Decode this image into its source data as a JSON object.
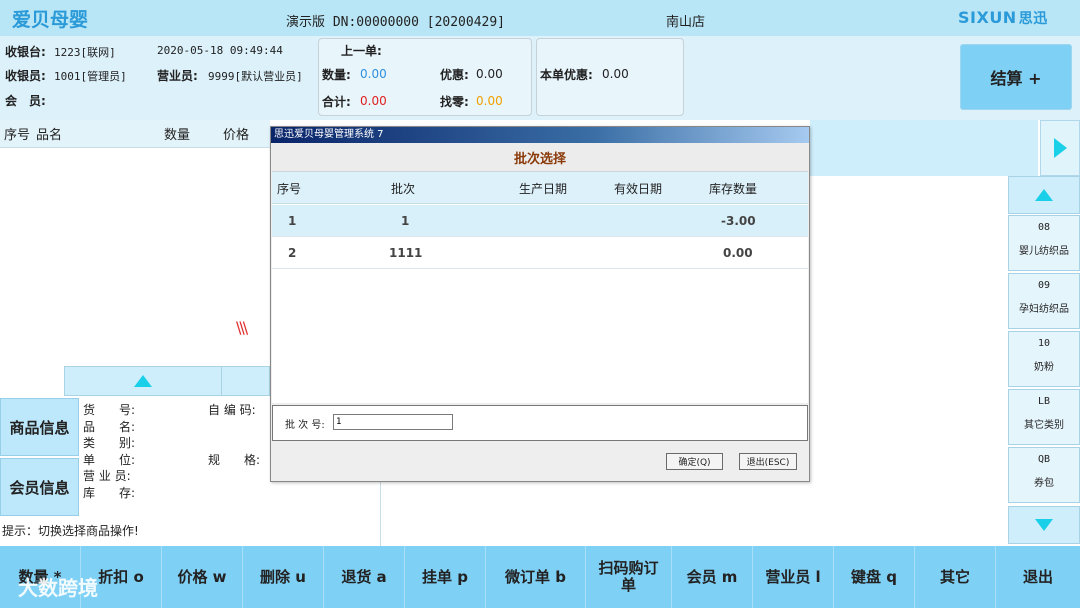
{
  "app": {
    "brand": "爱贝母婴",
    "title": "演示版 DN:00000000 [20200429]",
    "store": "南山店",
    "logo_main": "SIXUN",
    "logo_sub": "思迅"
  },
  "info": {
    "register_label": "收银台:",
    "register_value": "1223[联网]",
    "datetime": "2020-05-18 09:49:44",
    "cashier_label": "收银员:",
    "cashier_value": "1001[管理员]",
    "salesperson_label": "营业员:",
    "salesperson_value": "9999[默认营业员]",
    "member_label": "会　员:",
    "last_order_label": "上一单:",
    "qty_label": "数量:",
    "qty_value": "0.00",
    "discount_label": "优惠:",
    "discount_value": "0.00",
    "total_label": "合计:",
    "total_value": "0.00",
    "change_label": "找零:",
    "change_value": "0.00",
    "order_discount_label": "本单优惠:",
    "order_discount_value": "0.00",
    "checkout_label": "结算 +"
  },
  "list": {
    "col_seq": "序号",
    "col_name": "品名",
    "col_qty": "数量",
    "col_price": "价格",
    "hatch": "\\\\\\"
  },
  "side_buttons": {
    "product_info": "商品信息",
    "member_info": "会员信息"
  },
  "product_panel": {
    "item_no": "货　　号:",
    "name": "品　　名:",
    "category": "类　　别:",
    "unit": "单　　位:",
    "salesperson": "营 业 员:",
    "stock": "库　　存:",
    "self_code": "自 编 码:",
    "spec": "规　　格:"
  },
  "hint": "提示：切换选择商品操作!",
  "categories": [
    {
      "code": "08",
      "name": "婴儿纺织品"
    },
    {
      "code": "09",
      "name": "孕妇纺织品"
    },
    {
      "code": "10",
      "name": "奶粉"
    },
    {
      "code": "LB",
      "name": "其它类别"
    },
    {
      "code": "QB",
      "name": "券包"
    }
  ],
  "toolbar": [
    "数量 *",
    "折扣 o",
    "价格 w",
    "删除 u",
    "退货 a",
    "挂单 p",
    "微订单 b",
    "扫码购订单",
    "会员 m",
    "营业员 l",
    "键盘 q",
    "其它",
    "退出"
  ],
  "watermark": "大数跨境",
  "dialog": {
    "title": "思迅爱贝母婴管理系统 7",
    "heading": "批次选择",
    "columns": [
      "序号",
      "批次",
      "生产日期",
      "有效日期",
      "库存数量"
    ],
    "rows": [
      {
        "seq": "1",
        "batch": "1",
        "prod_date": "",
        "exp_date": "",
        "stock": "-3.00"
      },
      {
        "seq": "2",
        "batch": "1111",
        "prod_date": "",
        "exp_date": "",
        "stock": "0.00"
      }
    ],
    "batch_label": "批 次 号:",
    "batch_value": "1",
    "ok_label": "确定(Q)",
    "exit_label": "退出(ESC)"
  },
  "colors": {
    "topbar": "#b9e6f6",
    "toolbar": "#7fd0f5",
    "accent_cyan": "#19d0e8",
    "brand_blue": "#2a9ad8",
    "heading_brown": "#8b3a0a"
  }
}
